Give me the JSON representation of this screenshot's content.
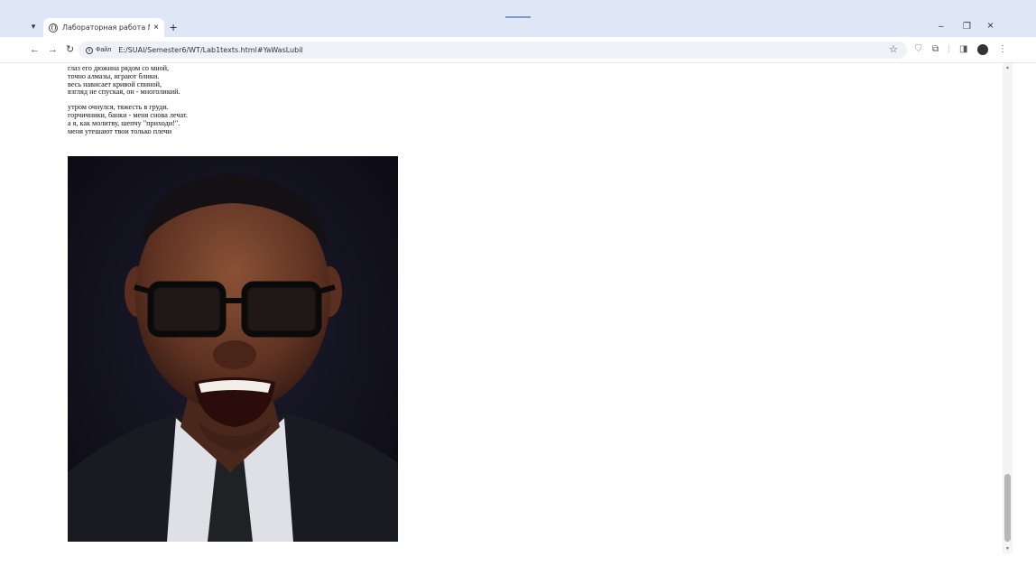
{
  "browser": {
    "tab_title": "Лабораторная работа №1: Те",
    "tab_close": "×",
    "new_tab": "+",
    "url_scheme_label": "Файл",
    "url": "E:/SUAI/Semester6/WT/Lab1texts.html#YaWasLubil",
    "icons": [
      "tab-search-icon",
      "site-info-icon",
      "back-arrow-icon",
      "forward-arrow-icon",
      "reload-icon",
      "star-icon",
      "shield-icon",
      "extensions-icon",
      "side-panel-icon",
      "profile-avatar-icon",
      "more-menu-icon",
      "minimize-icon",
      "restore-icon",
      "close-icon"
    ]
  },
  "page": {
    "stanza1": [
      "глаз его дюжина рядом со мной,",
      "точно алмазы, играют блики.",
      "весь нависает кривой спиной,",
      "взгляд не спуская, он - многоликий."
    ],
    "stanza2": [
      "утром очнулся, тяжесть в груди.",
      "горчичники, банки - меня снова лечат.",
      "а я, как молитву, шепчу \"приходи!\".",
      "меня утешают твои только плечи"
    ],
    "image": "photo of a laughing man in black glasses, dark suit and tie"
  }
}
